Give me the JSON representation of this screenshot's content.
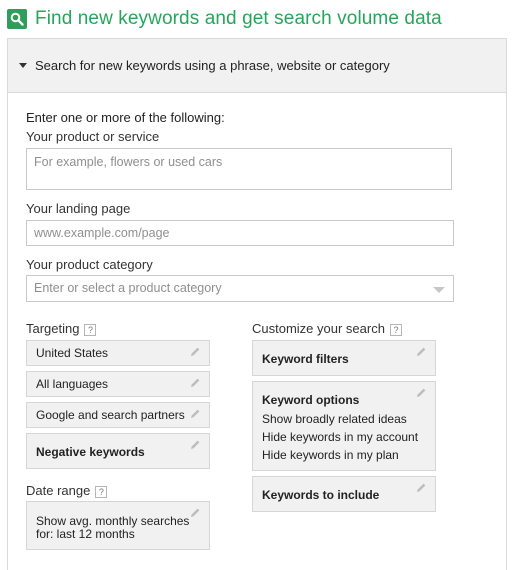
{
  "header": {
    "title": "Find new keywords and get search volume data",
    "icon": "search-icon"
  },
  "panel": {
    "title": "Search for new keywords using a phrase, website or category"
  },
  "form": {
    "intro": "Enter one or more of the following:",
    "product": {
      "label": "Your product or service",
      "placeholder": "For example, flowers or used cars"
    },
    "landing": {
      "label": "Your landing page",
      "placeholder": "www.example.com/page"
    },
    "category": {
      "label": "Your product category",
      "placeholder": "Enter or select a product category"
    }
  },
  "targeting": {
    "label": "Targeting",
    "help": "?",
    "items": [
      "United States",
      "All languages",
      "Google and search partners",
      "Negative keywords"
    ]
  },
  "date_range": {
    "label": "Date range",
    "help": "?",
    "line1": "Show avg. monthly searches",
    "line2": "for: last 12 months"
  },
  "customize": {
    "label": "Customize your search",
    "help": "?",
    "filters": "Keyword filters",
    "options": {
      "title": "Keyword options",
      "lines": [
        "Show broadly related ideas",
        "Hide keywords in my account",
        "Hide keywords in my plan"
      ]
    },
    "include": "Keywords to include"
  },
  "colors": {
    "brand_green": "#26a65b",
    "card_bg": "#f1f1f1"
  }
}
